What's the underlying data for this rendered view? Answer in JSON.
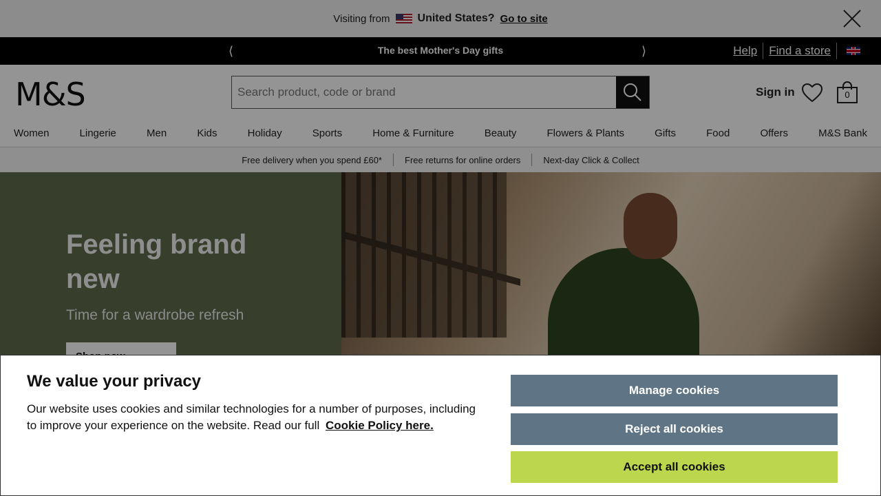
{
  "visit_bar": {
    "prefix": "Visiting from",
    "country": "United States?",
    "link": "Go to site"
  },
  "promo": {
    "message": "The best Mother's Day gifts",
    "help": "Help",
    "find_store": "Find a store"
  },
  "header": {
    "logo": "M&S",
    "search_placeholder": "Search product, code or brand",
    "sign_in": "Sign in",
    "bag_count": "0"
  },
  "nav": [
    "Women",
    "Lingerie",
    "Men",
    "Kids",
    "Holiday",
    "Sports",
    "Home & Furniture",
    "Beauty",
    "Flowers & Plants",
    "Gifts",
    "Food",
    "Offers",
    "M&S Bank"
  ],
  "delivery": [
    "Free delivery when you spend £60*",
    "Free returns for online orders",
    "Next-day Click & Collect"
  ],
  "hero": {
    "title": "Feeling brand new",
    "subtitle": "Time for a wardrobe refresh",
    "button": "Shop now"
  },
  "cookie": {
    "title": "We value your privacy",
    "text": "Our website uses cookies and similar technologies for a number of purposes, including to improve your experience on the website. Read our full",
    "link": "Cookie Policy here.",
    "manage": "Manage cookies",
    "reject": "Reject all cookies",
    "accept": "Accept all cookies"
  },
  "colors": {
    "promo_bg": "#000000",
    "hero_left": "#5f6b4d",
    "cookie_secondary": "#5f7484",
    "cookie_accept": "#bcd64d"
  }
}
